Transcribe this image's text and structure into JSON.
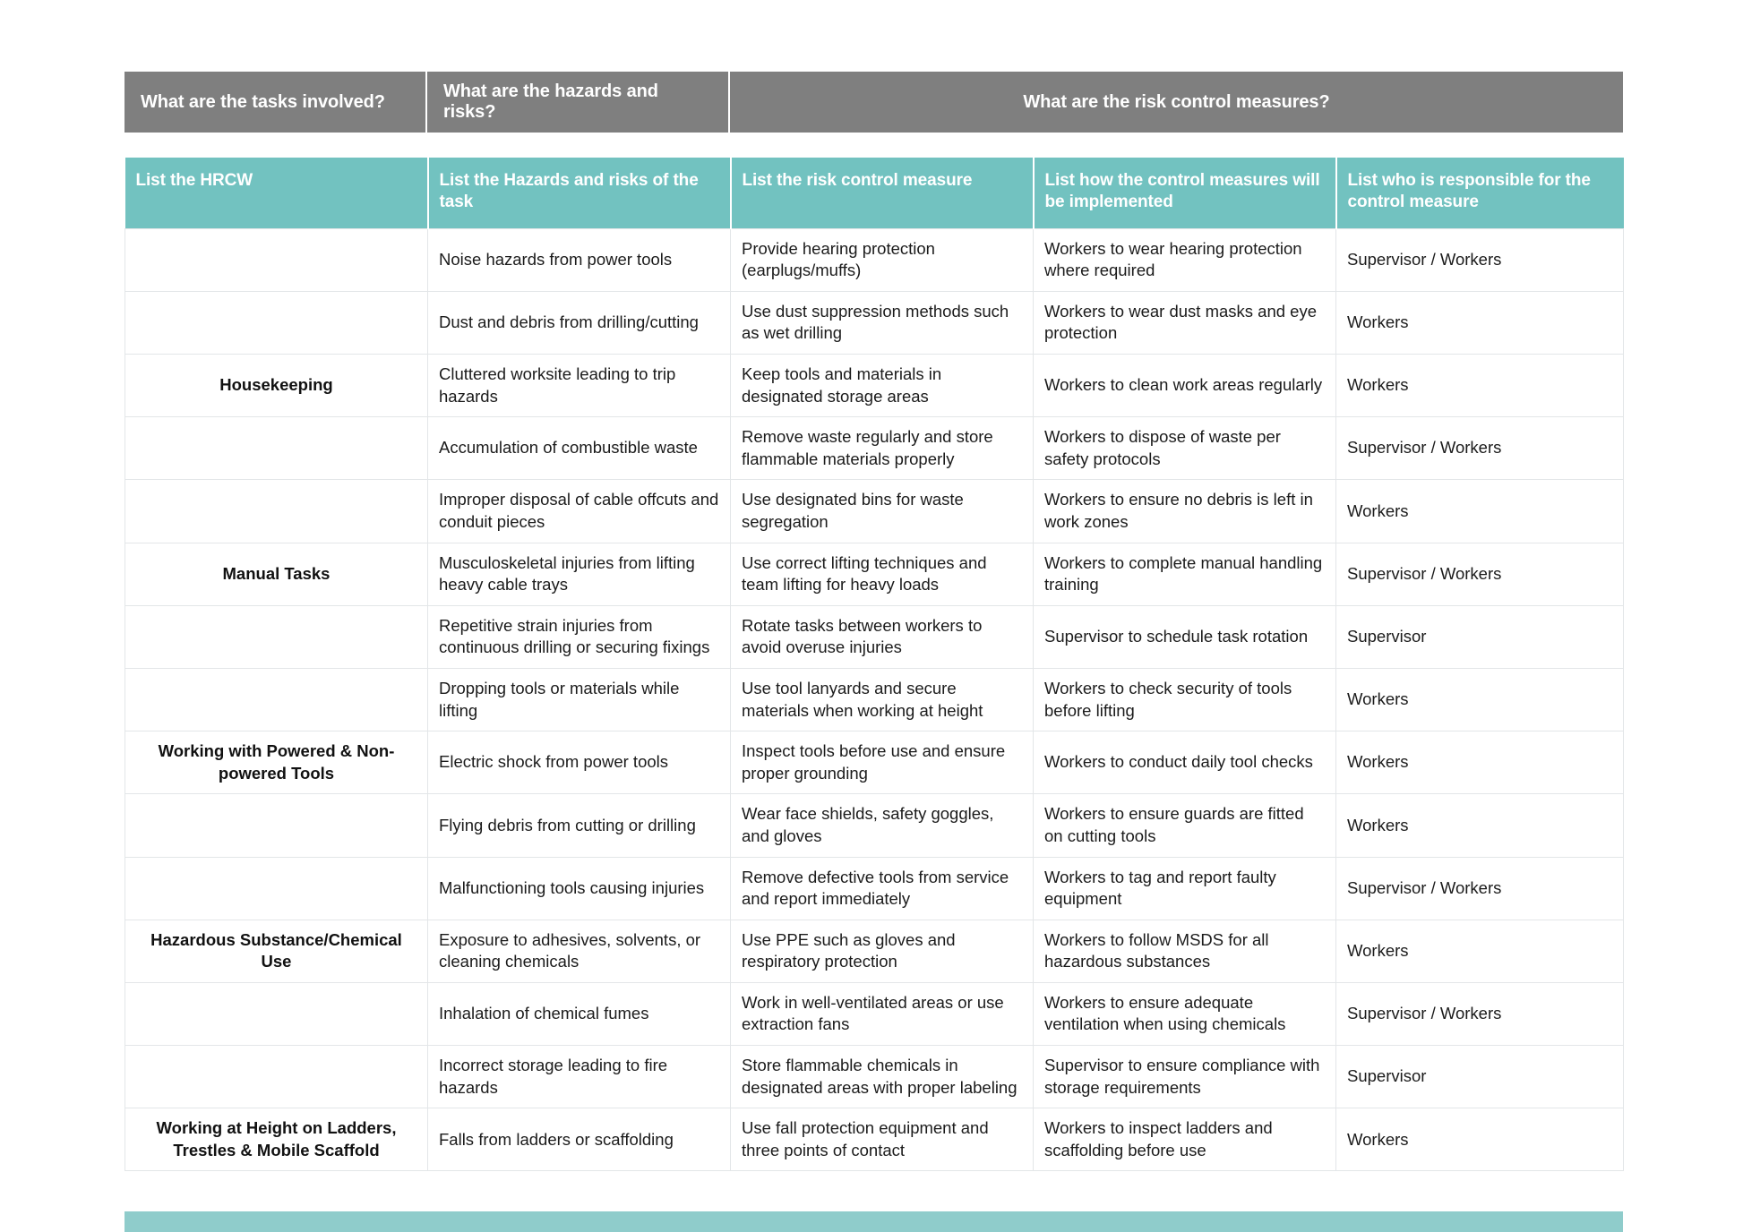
{
  "banner": {
    "cells": [
      "What are the tasks involved?",
      "What are the hazards and risks?",
      "What are the risk control measures?"
    ]
  },
  "colors": {
    "banner_grey": "#7f7f7f",
    "header_teal": "#72c2c0",
    "bottom_bar_teal": "#8fcccb",
    "grid_line": "#e3e6e8",
    "text": "#1b1b1b"
  },
  "table": {
    "headers": [
      "List the HRCW",
      "List the Hazards and risks of the task",
      "List the risk control measure",
      "List how the control measures will be implemented",
      "List who is responsible for the control measure"
    ],
    "rows": [
      {
        "task": "",
        "hazard": "Noise hazards from power tools",
        "control": "Provide hearing protection (earplugs/muffs)",
        "implementation": "Workers to wear hearing protection where required",
        "responsible": "Supervisor / Workers"
      },
      {
        "task": "",
        "hazard": "Dust and debris from drilling/cutting",
        "control": "Use dust suppression methods such as wet drilling",
        "implementation": "Workers to wear dust masks and eye protection",
        "responsible": "Workers"
      },
      {
        "task": "Housekeeping",
        "hazard": "Cluttered worksite leading to trip hazards",
        "control": "Keep tools and materials in designated storage areas",
        "implementation": "Workers to clean work areas regularly",
        "responsible": "Workers"
      },
      {
        "task": "",
        "hazard": "Accumulation of combustible waste",
        "control": "Remove waste regularly and store flammable materials properly",
        "implementation": "Workers to dispose of waste per safety protocols",
        "responsible": "Supervisor / Workers"
      },
      {
        "task": "",
        "hazard": "Improper disposal of cable offcuts and conduit pieces",
        "control": "Use designated bins for waste segregation",
        "implementation": "Workers to ensure no debris is left in work zones",
        "responsible": "Workers"
      },
      {
        "task": "Manual Tasks",
        "hazard": "Musculoskeletal injuries from lifting heavy cable trays",
        "control": "Use correct lifting techniques and team lifting for heavy loads",
        "implementation": "Workers to complete manual handling training",
        "responsible": "Supervisor / Workers"
      },
      {
        "task": "",
        "hazard": "Repetitive strain injuries from continuous drilling or securing fixings",
        "control": "Rotate tasks between workers to avoid overuse injuries",
        "implementation": "Supervisor to schedule task rotation",
        "responsible": "Supervisor"
      },
      {
        "task": "",
        "hazard": "Dropping tools or materials while lifting",
        "control": "Use tool lanyards and secure materials when working at height",
        "implementation": "Workers to check security of tools before lifting",
        "responsible": "Workers"
      },
      {
        "task": "Working with Powered & Non-powered Tools",
        "hazard": "Electric shock from power tools",
        "control": "Inspect tools before use and ensure proper grounding",
        "implementation": "Workers to conduct daily tool checks",
        "responsible": "Workers"
      },
      {
        "task": "",
        "hazard": "Flying debris from cutting or drilling",
        "control": "Wear face shields, safety goggles, and gloves",
        "implementation": "Workers to ensure guards are fitted on cutting tools",
        "responsible": "Workers"
      },
      {
        "task": "",
        "hazard": "Malfunctioning tools causing injuries",
        "control": "Remove defective tools from service and report immediately",
        "implementation": "Workers to tag and report faulty equipment",
        "responsible": "Supervisor / Workers"
      },
      {
        "task": "Hazardous Substance/Chemical Use",
        "hazard": "Exposure to adhesives, solvents, or cleaning chemicals",
        "control": "Use PPE such as gloves and respiratory protection",
        "implementation": "Workers to follow MSDS for all hazardous substances",
        "responsible": "Workers"
      },
      {
        "task": "",
        "hazard": "Inhalation of chemical fumes",
        "control": "Work in well-ventilated areas or use extraction fans",
        "implementation": "Workers to ensure adequate ventilation when using chemicals",
        "responsible": "Supervisor / Workers"
      },
      {
        "task": "",
        "hazard": "Incorrect storage leading to fire hazards",
        "control": "Store flammable chemicals in designated areas with proper labeling",
        "implementation": "Supervisor to ensure compliance with storage requirements",
        "responsible": "Supervisor"
      },
      {
        "task": "Working at Height on Ladders, Trestles & Mobile Scaffold",
        "hazard": "Falls from ladders or scaffolding",
        "control": "Use fall protection equipment and three points of contact",
        "implementation": "Workers to inspect ladders and scaffolding before use",
        "responsible": "Workers"
      }
    ]
  }
}
